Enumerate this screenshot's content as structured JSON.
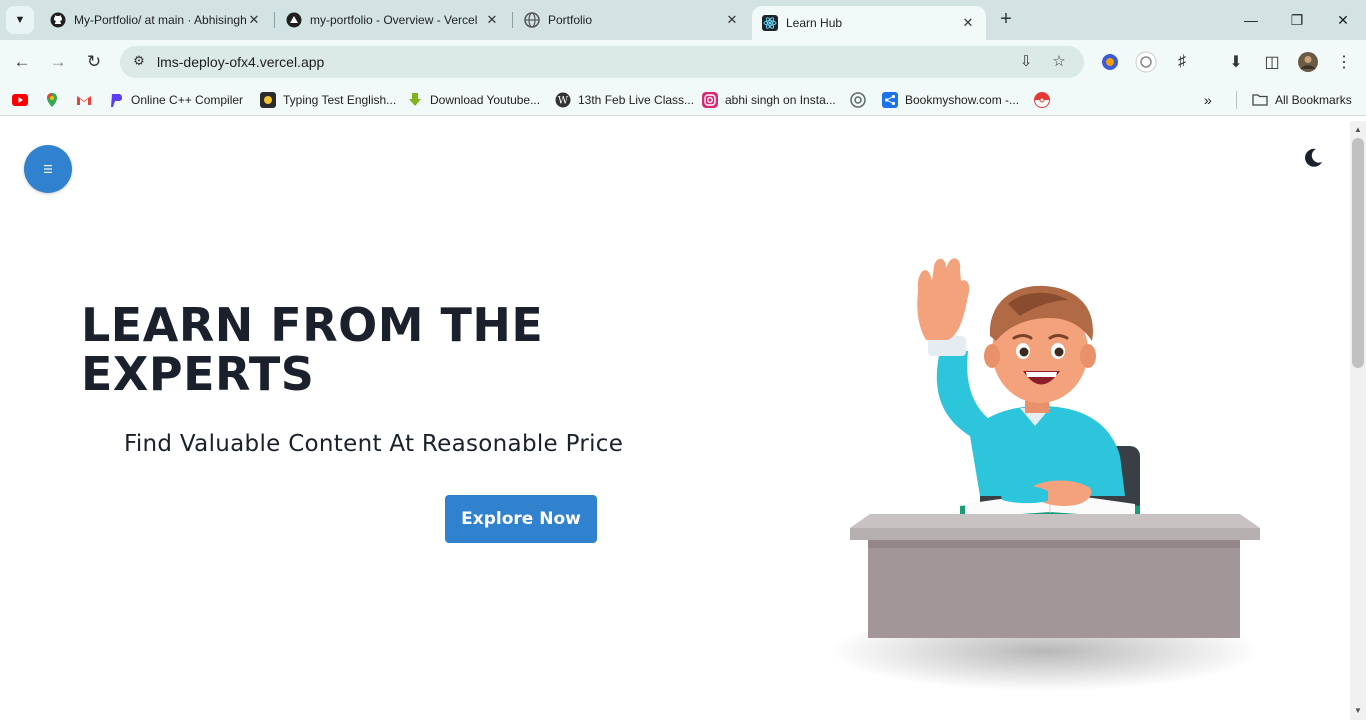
{
  "browser": {
    "tabs": [
      {
        "title": "My-Portfolio/ at main · Abhisingh",
        "active": false
      },
      {
        "title": "my-portfolio - Overview - Vercel",
        "active": false
      },
      {
        "title": "Portfolio",
        "active": false
      },
      {
        "title": "Learn Hub",
        "active": true
      }
    ],
    "url": "lms-deploy-ofx4.vercel.app",
    "bookmarks": [
      {
        "label": "",
        "icon": "youtube-icon",
        "color": "#ff0000"
      },
      {
        "label": "",
        "icon": "maps-icon",
        "color": "#34a853"
      },
      {
        "label": "",
        "icon": "gmail-icon",
        "color": "#ea4335"
      },
      {
        "label": "Online C++ Compiler",
        "icon": "programiz-icon",
        "color": "#5c3df5"
      },
      {
        "label": "Typing Test English...",
        "icon": "typing-icon",
        "color": "#2b2b2b"
      },
      {
        "label": "Download Youtube...",
        "icon": "download-arrow-icon",
        "color": "#7cb518"
      },
      {
        "label": "13th Feb Live Class...",
        "icon": "wordpress-icon",
        "color": "#333333"
      },
      {
        "label": "abhi singh on Insta...",
        "icon": "instagram-icon",
        "color": "#d62976"
      },
      {
        "label": "",
        "icon": "chatgpt-icon",
        "color": "#5a6b6a"
      },
      {
        "label": "Bookmyshow.com -...",
        "icon": "share-icon",
        "color": "#1a73e8"
      },
      {
        "label": "",
        "icon": "pokeball-icon",
        "color": "#e53935"
      }
    ],
    "all_bookmarks_label": "All Bookmarks"
  },
  "page": {
    "hero_title": "LEARN FROM THE EXPERTS",
    "hero_subtitle": "Find Valuable Content At Reasonable Price",
    "cta_label": "Explore Now",
    "accent_color": "#3182ce",
    "menu_icon": "hamburger-icon",
    "theme_icon": "moon-icon"
  }
}
